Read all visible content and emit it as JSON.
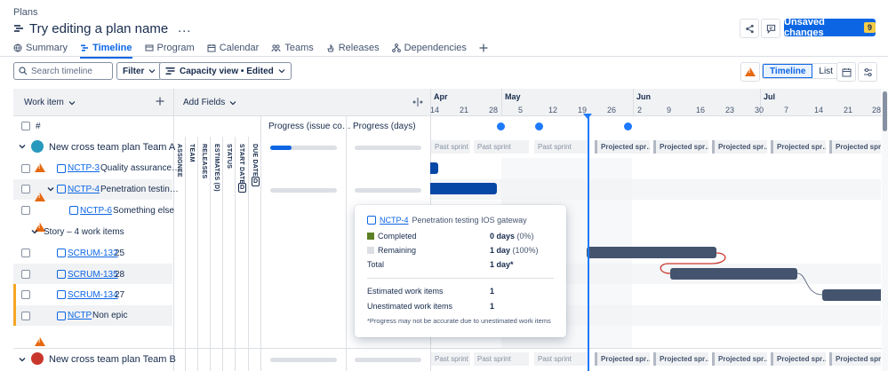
{
  "header": {
    "breadcrumb": "Plans",
    "title": "Try editing a plan name",
    "more": "…",
    "unsaved_label": "Unsaved changes",
    "unsaved_count": "9"
  },
  "tabs": [
    {
      "label": "Summary",
      "icon": "globe-icon"
    },
    {
      "label": "Timeline",
      "icon": "timeline-icon",
      "active": true
    },
    {
      "label": "Program",
      "icon": "program-icon"
    },
    {
      "label": "Calendar",
      "icon": "calendar-icon"
    },
    {
      "label": "Teams",
      "icon": "teams-icon"
    },
    {
      "label": "Releases",
      "icon": "ship-icon"
    },
    {
      "label": "Dependencies",
      "icon": "dependencies-icon"
    }
  ],
  "toolbar": {
    "search_placeholder": "Search timeline",
    "filter_label": "Filter",
    "view_label": "Capacity view • Edited",
    "timeline_label": "Timeline",
    "list_label": "List"
  },
  "grid": {
    "work_item_header": "Work item",
    "add_fields": "Add Fields",
    "hash": "#",
    "progress_issue": "Progress (issue co…",
    "progress_days": "Progress (days)",
    "field_columns": [
      "ASSIGNEE",
      "TEAM",
      "RELEASES",
      "ESTIMATES (D)",
      "STATUS",
      "START DATE",
      "DUE DATE"
    ],
    "field_badge": "D",
    "rows": [
      {
        "key": "",
        "title": "New cross team plan Team A",
        "type": "team"
      },
      {
        "key": "NCTP-3",
        "title": "Quality assurance…",
        "type": "item"
      },
      {
        "key": "NCTP-4",
        "title": "Penetration testin…",
        "type": "item"
      },
      {
        "key": "NCTP-6",
        "title": "Something else",
        "type": "item"
      },
      {
        "key": "",
        "title": "Story – 4 work items",
        "type": "group"
      },
      {
        "key": "SCRUM-132",
        "title": "25",
        "type": "item"
      },
      {
        "key": "SCRUM-135",
        "title": "28",
        "type": "item"
      },
      {
        "key": "SCRUM-134",
        "title": "27",
        "type": "item"
      },
      {
        "key": "NCTP",
        "title": "Non epic",
        "type": "item"
      },
      {
        "key": "",
        "title": "New cross team plan Team B",
        "type": "team"
      }
    ]
  },
  "timeline": {
    "months": [
      "Apr",
      "May",
      "Jun",
      "Jul"
    ],
    "days": [
      "14",
      "21",
      "28",
      "5",
      "12",
      "19",
      "26",
      "2",
      "9",
      "16",
      "23",
      "30",
      "7",
      "14",
      "21",
      "28"
    ],
    "sprints": [
      "Past sprint",
      "Past sprint",
      "Past sprint",
      "Projected spr…",
      "Projected spr…",
      "Projected spr…",
      "Projected spr…",
      "Projected spr…"
    ]
  },
  "tooltip": {
    "key": "NCTP-4",
    "title": "Penetration testing IOS gateway",
    "completed_label": "Completed",
    "completed_value": "0 days",
    "completed_pct": "(0%)",
    "remaining_label": "Remaining",
    "remaining_value": "1 day",
    "remaining_pct": "(100%)",
    "total_label": "Total",
    "total_value": "1 day*",
    "estimated_label": "Estimated work items",
    "estimated_value": "1",
    "unestimated_label": "Unestimated work items",
    "unestimated_value": "1",
    "note": "*Progress may not be accurate due to unestimated work items"
  },
  "colors": {
    "primary": "#0c66e4",
    "bar_dark": "#44546f",
    "bar_blue": "#0747a6",
    "warning": "#e56910",
    "completed": "#5b7f24",
    "dependency": "#c9372c"
  }
}
